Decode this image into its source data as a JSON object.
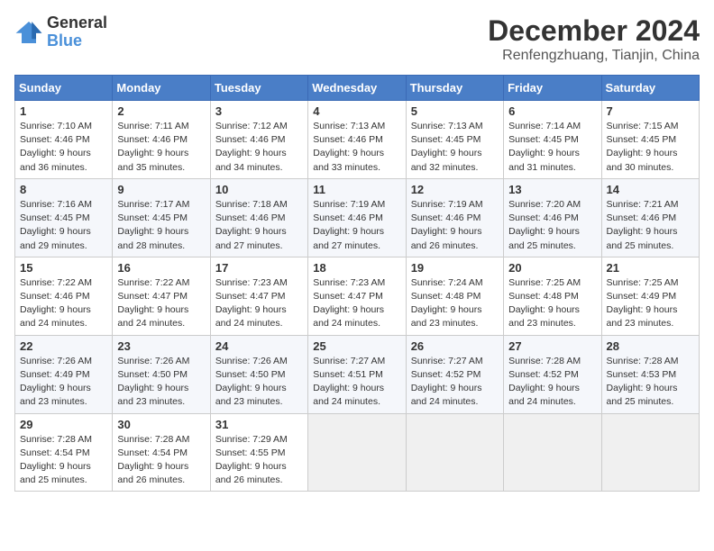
{
  "logo": {
    "general": "General",
    "blue": "Blue"
  },
  "title": {
    "month": "December 2024",
    "location": "Renfengzhuang, Tianjin, China"
  },
  "headers": [
    "Sunday",
    "Monday",
    "Tuesday",
    "Wednesday",
    "Thursday",
    "Friday",
    "Saturday"
  ],
  "weeks": [
    [
      {
        "day": "1",
        "sunrise": "7:10 AM",
        "sunset": "4:46 PM",
        "daylight": "9 hours and 36 minutes."
      },
      {
        "day": "2",
        "sunrise": "7:11 AM",
        "sunset": "4:46 PM",
        "daylight": "9 hours and 35 minutes."
      },
      {
        "day": "3",
        "sunrise": "7:12 AM",
        "sunset": "4:46 PM",
        "daylight": "9 hours and 34 minutes."
      },
      {
        "day": "4",
        "sunrise": "7:13 AM",
        "sunset": "4:46 PM",
        "daylight": "9 hours and 33 minutes."
      },
      {
        "day": "5",
        "sunrise": "7:13 AM",
        "sunset": "4:45 PM",
        "daylight": "9 hours and 32 minutes."
      },
      {
        "day": "6",
        "sunrise": "7:14 AM",
        "sunset": "4:45 PM",
        "daylight": "9 hours and 31 minutes."
      },
      {
        "day": "7",
        "sunrise": "7:15 AM",
        "sunset": "4:45 PM",
        "daylight": "9 hours and 30 minutes."
      }
    ],
    [
      {
        "day": "8",
        "sunrise": "7:16 AM",
        "sunset": "4:45 PM",
        "daylight": "9 hours and 29 minutes."
      },
      {
        "day": "9",
        "sunrise": "7:17 AM",
        "sunset": "4:45 PM",
        "daylight": "9 hours and 28 minutes."
      },
      {
        "day": "10",
        "sunrise": "7:18 AM",
        "sunset": "4:46 PM",
        "daylight": "9 hours and 27 minutes."
      },
      {
        "day": "11",
        "sunrise": "7:19 AM",
        "sunset": "4:46 PM",
        "daylight": "9 hours and 27 minutes."
      },
      {
        "day": "12",
        "sunrise": "7:19 AM",
        "sunset": "4:46 PM",
        "daylight": "9 hours and 26 minutes."
      },
      {
        "day": "13",
        "sunrise": "7:20 AM",
        "sunset": "4:46 PM",
        "daylight": "9 hours and 25 minutes."
      },
      {
        "day": "14",
        "sunrise": "7:21 AM",
        "sunset": "4:46 PM",
        "daylight": "9 hours and 25 minutes."
      }
    ],
    [
      {
        "day": "15",
        "sunrise": "7:22 AM",
        "sunset": "4:46 PM",
        "daylight": "9 hours and 24 minutes."
      },
      {
        "day": "16",
        "sunrise": "7:22 AM",
        "sunset": "4:47 PM",
        "daylight": "9 hours and 24 minutes."
      },
      {
        "day": "17",
        "sunrise": "7:23 AM",
        "sunset": "4:47 PM",
        "daylight": "9 hours and 24 minutes."
      },
      {
        "day": "18",
        "sunrise": "7:23 AM",
        "sunset": "4:47 PM",
        "daylight": "9 hours and 24 minutes."
      },
      {
        "day": "19",
        "sunrise": "7:24 AM",
        "sunset": "4:48 PM",
        "daylight": "9 hours and 23 minutes."
      },
      {
        "day": "20",
        "sunrise": "7:25 AM",
        "sunset": "4:48 PM",
        "daylight": "9 hours and 23 minutes."
      },
      {
        "day": "21",
        "sunrise": "7:25 AM",
        "sunset": "4:49 PM",
        "daylight": "9 hours and 23 minutes."
      }
    ],
    [
      {
        "day": "22",
        "sunrise": "7:26 AM",
        "sunset": "4:49 PM",
        "daylight": "9 hours and 23 minutes."
      },
      {
        "day": "23",
        "sunrise": "7:26 AM",
        "sunset": "4:50 PM",
        "daylight": "9 hours and 23 minutes."
      },
      {
        "day": "24",
        "sunrise": "7:26 AM",
        "sunset": "4:50 PM",
        "daylight": "9 hours and 23 minutes."
      },
      {
        "day": "25",
        "sunrise": "7:27 AM",
        "sunset": "4:51 PM",
        "daylight": "9 hours and 24 minutes."
      },
      {
        "day": "26",
        "sunrise": "7:27 AM",
        "sunset": "4:52 PM",
        "daylight": "9 hours and 24 minutes."
      },
      {
        "day": "27",
        "sunrise": "7:28 AM",
        "sunset": "4:52 PM",
        "daylight": "9 hours and 24 minutes."
      },
      {
        "day": "28",
        "sunrise": "7:28 AM",
        "sunset": "4:53 PM",
        "daylight": "9 hours and 25 minutes."
      }
    ],
    [
      {
        "day": "29",
        "sunrise": "7:28 AM",
        "sunset": "4:54 PM",
        "daylight": "9 hours and 25 minutes."
      },
      {
        "day": "30",
        "sunrise": "7:28 AM",
        "sunset": "4:54 PM",
        "daylight": "9 hours and 26 minutes."
      },
      {
        "day": "31",
        "sunrise": "7:29 AM",
        "sunset": "4:55 PM",
        "daylight": "9 hours and 26 minutes."
      },
      null,
      null,
      null,
      null
    ]
  ],
  "labels": {
    "sunrise": "Sunrise:",
    "sunset": "Sunset:",
    "daylight": "Daylight:"
  }
}
